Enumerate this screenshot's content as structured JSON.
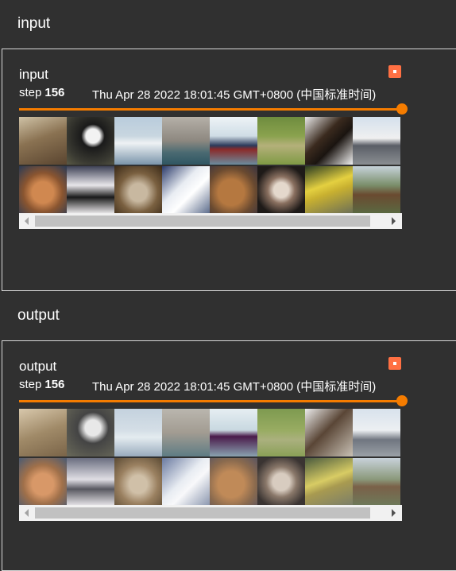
{
  "sections": [
    {
      "header": "input",
      "card": {
        "title": "input",
        "step_label": "step",
        "step_value": "156",
        "timestamp": "Thu Apr 28 2022 18:01:45 GMT+0800 (中国标准时间)"
      },
      "tiles": [
        {
          "name": "horse-rider",
          "bg": "linear-gradient(160deg,#cfc2a6 0%,#8a7252 45%,#5a4530 100%)"
        },
        {
          "name": "dog-black-white",
          "bg": "radial-gradient(circle at 55% 40%,#f2f2f2 0 18%,#1a1a1a 30%,#3a3a32 70%,#5a5a46 100%)"
        },
        {
          "name": "boat",
          "bg": "linear-gradient(180deg,#b9ccdc 0%,#c8d6e0 40%,#eef2f4 55%,#7a94aa 100%)"
        },
        {
          "name": "seal",
          "bg": "linear-gradient(180deg,#b5b0a8 0%,#8d8880 50%,#4a6a72 75%,#2f5662 100%)"
        },
        {
          "name": "ship",
          "bg": "linear-gradient(180deg,#eef3f6 0%,#cfdde6 40%,#2b3a5a 60%,#8a2a2a 68%,#6b8c9e 100%)"
        },
        {
          "name": "deer",
          "bg": "linear-gradient(180deg,#6e8c3e 0%,#8aa24e 40%,#b4b07a 60%,#7f9a44 100%)"
        },
        {
          "name": "horse-head",
          "bg": "linear-gradient(135deg,#e8e8e8 0%,#3a2a1e 40%,#1a1410 60%,#f2f2f2 100%)"
        },
        {
          "name": "airplane",
          "bg": "linear-gradient(180deg,#d4e0ec 0%,#f0f0f0 45%,#5a5e66 60%,#8a8e92 100%)"
        },
        {
          "name": "cat-orange",
          "bg": "radial-gradient(circle at 50% 55%,#d08850 0 30%,#8a5530 55%,#2a3a55 100%)"
        },
        {
          "name": "dog-long-hair",
          "bg": "linear-gradient(180deg,#3e4256 0%,#e8e6ea 40%,#1a1a1a 65%,#f0eef0 100%)"
        },
        {
          "name": "cat-tabby",
          "bg": "radial-gradient(circle at 50% 55%,#c8b8a0 0 25%,#7a6040 55%,#3a2a18 100%)"
        },
        {
          "name": "bird-white",
          "bg": "linear-gradient(135deg,#2a3a6a 0%,#e8ecf2 40%,#ffffff 60%,#5a6a8a 100%)"
        },
        {
          "name": "dog-brown",
          "bg": "radial-gradient(circle at 45% 55%,#b57840 0 35%,#6a4a30 65%,#3a3440 100%)"
        },
        {
          "name": "dog-shih-tzu",
          "bg": "radial-gradient(circle at 50% 50%,#e4d8cc 0 22%,#8a7060 40%,#1e1a18 75%)"
        },
        {
          "name": "car-yellow",
          "bg": "linear-gradient(160deg,#2a3a22 0%,#e4d040 40%,#c8b030 55%,#6a6e58 100%)"
        },
        {
          "name": "horse-brown",
          "bg": "linear-gradient(180deg,#c6d2da 0%,#7a8e6a 40%,#6a4a30 60%,#5a6a42 100%)"
        }
      ]
    },
    {
      "header": "output",
      "card": {
        "title": "output",
        "step_label": "step",
        "step_value": "156",
        "timestamp": "Thu Apr 28 2022 18:01:45 GMT+0800 (中国标准时间)"
      },
      "tiles": [
        {
          "name": "horse-rider-recon",
          "bg": "linear-gradient(160deg,#d8c8ac 0%,#a08a68 50%,#7a6448 100%)"
        },
        {
          "name": "dog-recon",
          "bg": "radial-gradient(circle at 55% 40%,#e8e8e8 0 20%,#444 40%,#6a6a5a 100%)"
        },
        {
          "name": "boat-recon",
          "bg": "linear-gradient(180deg,#c4d2de 0%,#d4dee6 45%,#e4ecf0 60%,#98aabc 100%)"
        },
        {
          "name": "seal-recon",
          "bg": "linear-gradient(180deg,#bab6ae 0%,#a29c92 50%,#5e7c84 100%)"
        },
        {
          "name": "ship-recon",
          "bg": "linear-gradient(180deg,#e6eef2 0%,#c8d8e0 45%,#4a1a4a 58%,#8aa2b0 100%)"
        },
        {
          "name": "deer-recon",
          "bg": "linear-gradient(180deg,#7e9a50 0%,#98ac62 45%,#aab07e 65%,#8aa056 100%)"
        },
        {
          "name": "horse-head-recon",
          "bg": "linear-gradient(135deg,#ececec 0%,#5a4636 45%,#c8c0b4 100%)"
        },
        {
          "name": "airplane-recon",
          "bg": "linear-gradient(180deg,#d8e2ec 0%,#eceff2 45%,#707680 65%,#9aa0a6 100%)"
        },
        {
          "name": "cat-orange-recon",
          "bg": "radial-gradient(circle at 50% 55%,#d89868 0 30%,#a0704a 55%,#4a5a72 100%)"
        },
        {
          "name": "dog-long-hair-recon",
          "bg": "linear-gradient(180deg,#6a6e80 0%,#e0dee4 45%,#585860 65%,#e8e6ea 100%)"
        },
        {
          "name": "cat-tabby-recon",
          "bg": "radial-gradient(circle at 50% 55%,#d0c0a8 0 25%,#9a8060 55%,#5a4a34 100%)"
        },
        {
          "name": "bird-white-recon",
          "bg": "linear-gradient(135deg,#6a7aa0 0%,#e8ecf2 45%,#f8f8fa 60%,#8a96ae 100%)"
        },
        {
          "name": "dog-brown-recon",
          "bg": "radial-gradient(circle at 45% 55%,#c08a58 0 35%,#8a6a4e 65%,#5a5460 100%)"
        },
        {
          "name": "dog-shih-tzu-recon",
          "bg": "radial-gradient(circle at 50% 50%,#d8ccc0 0 25%,#8a786a 45%,#3a3432 80%)"
        },
        {
          "name": "car-yellow-recon",
          "bg": "linear-gradient(160deg,#4a5a3e 0%,#d8cc64 45%,#a89a50 60%,#7a7e6a 100%)"
        },
        {
          "name": "horse-brown-recon",
          "bg": "linear-gradient(180deg,#c8d2da 0%,#8a987a 45%,#7a6048 60%,#6e7a5a 100%)"
        }
      ]
    }
  ]
}
